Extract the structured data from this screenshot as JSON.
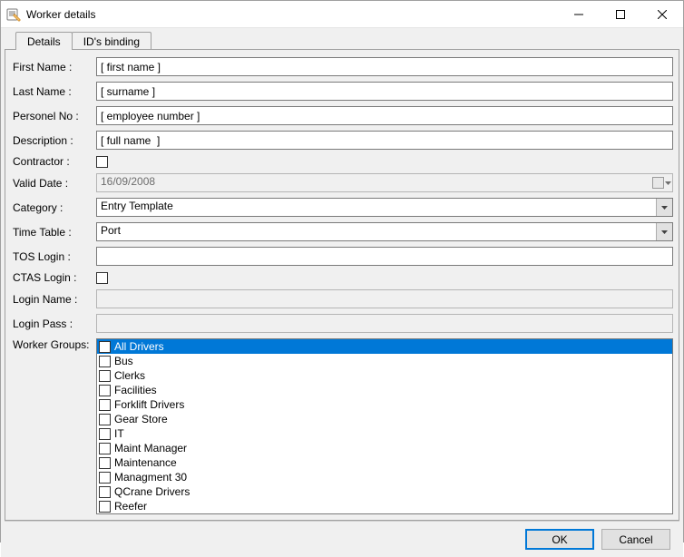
{
  "window": {
    "title": "Worker details",
    "minimize_tooltip": "Minimize",
    "maximize_tooltip": "Maximize",
    "close_tooltip": "Close"
  },
  "tabs": {
    "details": "Details",
    "ids_binding": "ID's binding"
  },
  "labels": {
    "first_name": "First Name :",
    "last_name": "Last Name :",
    "personel_no": "Personel No :",
    "description": "Description :",
    "contractor": "Contractor :",
    "valid_date": "Valid Date :",
    "category": "Category :",
    "time_table": "Time Table :",
    "tos_login": "TOS Login :",
    "ctas_login": "CTAS Login :",
    "login_name": "Login Name :",
    "login_pass": "Login Pass :",
    "worker_groups": "Worker Groups:"
  },
  "fields": {
    "first_name": "[ first name ]",
    "last_name": "[ surname ]",
    "personel_no": "[ employee number ]",
    "description": "[ full name  ]",
    "contractor_checked": false,
    "valid_date": "16/09/2008",
    "category": "Entry Template",
    "time_table": "Port",
    "tos_login": "",
    "ctas_login_checked": false,
    "login_name": "",
    "login_pass": ""
  },
  "worker_groups": [
    {
      "label": "All Drivers",
      "checked": false,
      "selected": true
    },
    {
      "label": "Bus",
      "checked": false,
      "selected": false
    },
    {
      "label": "Clerks",
      "checked": false,
      "selected": false
    },
    {
      "label": "Facilities",
      "checked": false,
      "selected": false
    },
    {
      "label": "Forklift Drivers",
      "checked": false,
      "selected": false
    },
    {
      "label": "Gear Store",
      "checked": false,
      "selected": false
    },
    {
      "label": "IT",
      "checked": false,
      "selected": false
    },
    {
      "label": "Maint Manager",
      "checked": false,
      "selected": false
    },
    {
      "label": "Maintenance",
      "checked": false,
      "selected": false
    },
    {
      "label": "Managment 30",
      "checked": false,
      "selected": false
    },
    {
      "label": "QCrane Drivers",
      "checked": false,
      "selected": false
    },
    {
      "label": "Reefer",
      "checked": false,
      "selected": false
    }
  ],
  "buttons": {
    "ok": "OK",
    "cancel": "Cancel"
  }
}
